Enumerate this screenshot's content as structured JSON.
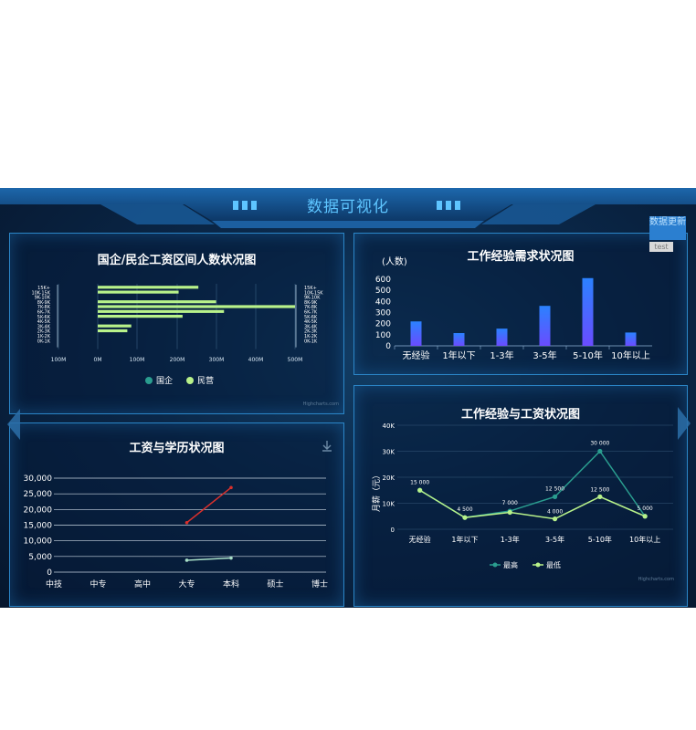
{
  "header": {
    "title": "数据可视化",
    "update_button": "数据更新",
    "test_button": "test"
  },
  "chart_data": [
    {
      "type": "bar",
      "orientation": "horizontal",
      "title": "国企/民企工资区间人数状况图",
      "categories": [
        "15K+",
        "10K-15K",
        "9K-10K",
        "8K-9K",
        "7K-8K",
        "6K-7K",
        "5K-6K",
        "4K-5K",
        "3K-4K",
        "2K-3K",
        "1K-2K",
        "0K-1K"
      ],
      "x_ticks": [
        "100M",
        "0M",
        "100M",
        "200M",
        "300M",
        "400M",
        "500M"
      ],
      "series": [
        {
          "name": "国企",
          "color": "#2a9d8f",
          "values": [
            0,
            0,
            0,
            0,
            0,
            0,
            0,
            0,
            0,
            0,
            0,
            0
          ]
        },
        {
          "name": "民营",
          "color": "#b8f28a",
          "values": [
            255,
            205,
            0,
            300,
            500,
            320,
            215,
            0,
            85,
            75,
            0,
            0
          ]
        }
      ],
      "credits": "Highcharts.com"
    },
    {
      "type": "bar",
      "title": "工作经验需求状况图",
      "ylabel": "(人数)",
      "categories": [
        "无经验",
        "1年以下",
        "1-3年",
        "3-5年",
        "5-10年",
        "10年以上"
      ],
      "values": [
        220,
        115,
        155,
        360,
        610,
        120
      ],
      "ylim": [
        0,
        600
      ],
      "y_ticks": [
        "0",
        "100",
        "200",
        "300",
        "400",
        "500",
        "600"
      ]
    },
    {
      "type": "line",
      "title": "工资与学历状况图",
      "categories": [
        "中技",
        "中专",
        "高中",
        "大专",
        "本科",
        "硕士",
        "博士"
      ],
      "y_ticks": [
        "0",
        "5,000",
        "10,000",
        "15,000",
        "20,000",
        "25,000",
        "30,000"
      ],
      "ylim": [
        0,
        30000
      ],
      "series": [
        {
          "color": "#d9302c",
          "values": [
            null,
            null,
            null,
            15800,
            27000,
            null,
            null
          ]
        },
        {
          "color": "#a9e0c8",
          "values": [
            null,
            null,
            null,
            3800,
            4500,
            null,
            null
          ]
        }
      ]
    },
    {
      "type": "line",
      "title": "工作经验与工资状况图",
      "ylabel": "月薪（元）",
      "categories": [
        "无经验",
        "1年以下",
        "1-3年",
        "3-5年",
        "5-10年",
        "10年以上"
      ],
      "y_ticks": [
        "0",
        "10K",
        "20K",
        "30K",
        "40K"
      ],
      "ylim": [
        0,
        40000
      ],
      "series": [
        {
          "name": "最高",
          "color": "#2a9d8f",
          "values": [
            15000,
            4500,
            7000,
            12500,
            30000,
            5000
          ]
        },
        {
          "name": "最低",
          "color": "#b8f28a",
          "values": [
            15000,
            4500,
            6500,
            4000,
            12500,
            5000
          ]
        }
      ],
      "data_labels": [
        "15 000",
        "4 500",
        "7 000",
        "12 500",
        "30 000",
        "5 000",
        "4 000",
        "12 500"
      ],
      "credits": "Highcharts.com"
    }
  ]
}
